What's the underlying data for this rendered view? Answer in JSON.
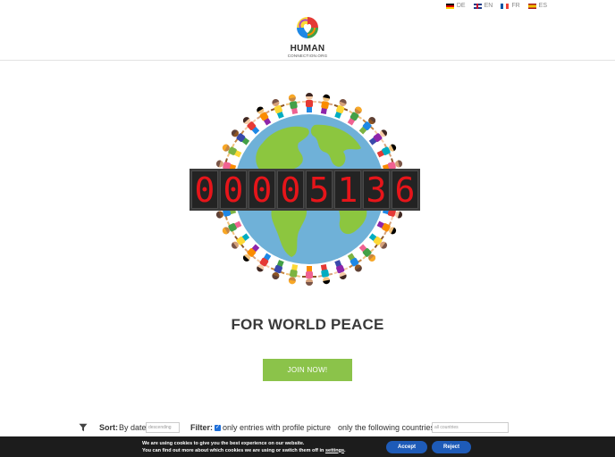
{
  "languages": [
    {
      "code": "DE",
      "flag": "de-flag-icon"
    },
    {
      "code": "EN",
      "flag": "uk-flag-icon"
    },
    {
      "code": "FR",
      "flag": "fr-flag-icon"
    },
    {
      "code": "ES",
      "flag": "es-flag-icon"
    }
  ],
  "logo": {
    "title": "HUMAN",
    "subtitle": "CONNECTION.ORG",
    "icon": "heart-globe-logo-icon"
  },
  "counter": {
    "digits": [
      "0",
      "0",
      "0",
      "0",
      "5",
      "1",
      "3",
      "6"
    ],
    "value": "00005136"
  },
  "headline": "FOR WORLD PEACE",
  "join_button": "JOIN NOW!",
  "filter_bar": {
    "funnel_icon": "filter-funnel-icon",
    "sort_label": "Sort:",
    "sort_by": "By date",
    "sort_order": "descending",
    "filter_label": "Filter:",
    "profile_picture_checked": true,
    "profile_picture_text": "only entries with profile picture",
    "countries_text": "only the following countries",
    "countries_placeholder": "all countries"
  },
  "cookie_banner": {
    "line1": "We are using cookies to give you the best experience on our website.",
    "line2_prefix": "You can find out more about which cookies we are using or switch them off in ",
    "settings_link": "settings",
    "line2_suffix": ".",
    "accept": "Accept",
    "reject": "Reject"
  },
  "colors": {
    "ocean": "#6fb1d8",
    "land": "#8cc63f",
    "counter_red": "#e6151a",
    "join_green": "#8bc34a",
    "cookie_bg": "#1c1c1c",
    "button_blue": "#1e5bb8"
  }
}
